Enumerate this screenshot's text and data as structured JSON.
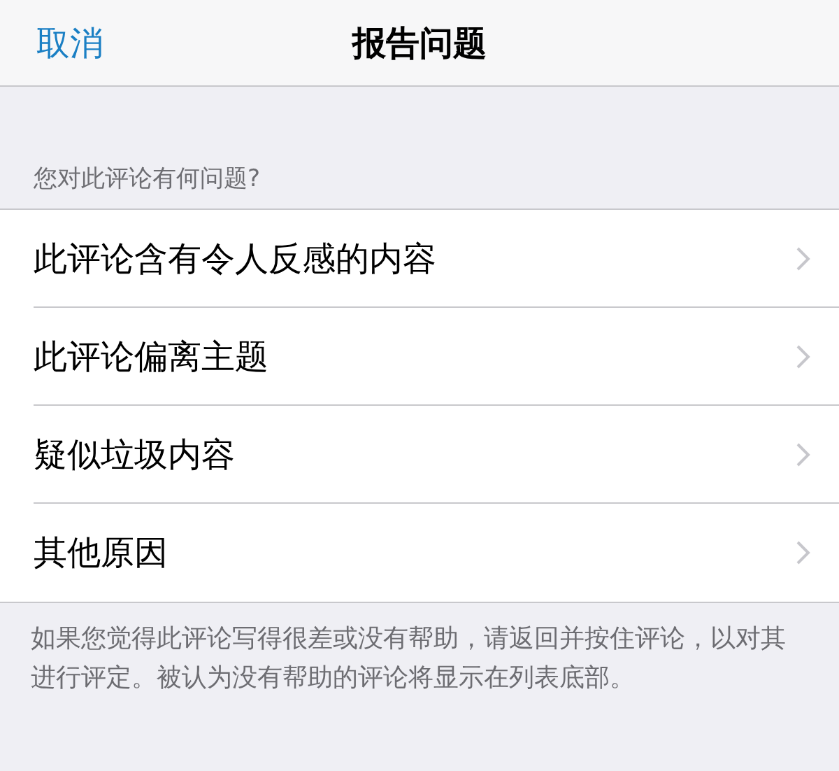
{
  "nav": {
    "cancel": "取消",
    "title": "报告问题"
  },
  "section_header": "您对此评论有何问题?",
  "items": [
    {
      "label": "此评论含有令人反感的内容"
    },
    {
      "label": "此评论偏离主题"
    },
    {
      "label": "疑似垃圾内容"
    },
    {
      "label": "其他原因"
    }
  ],
  "footer": "如果您觉得此评论写得很差或没有帮助，请返回并按住评论，以对其进行评定。被认为没有帮助的评论将显示在列表底部。"
}
